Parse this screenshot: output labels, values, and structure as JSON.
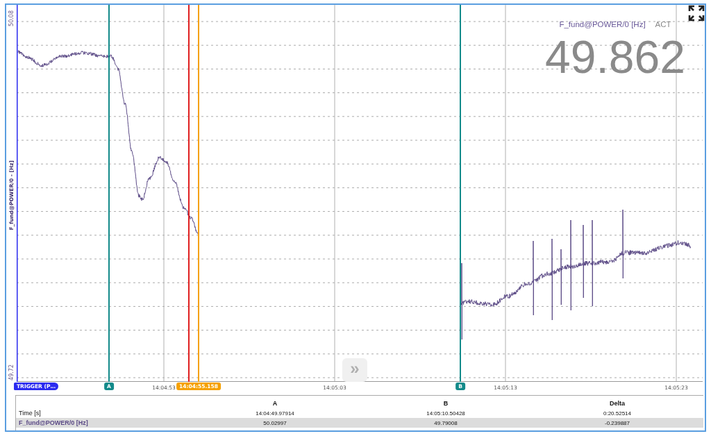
{
  "axis": {
    "label": "F_fund@POWER/0 - [Hz]",
    "y_max": "50.08",
    "y_min": "49.72"
  },
  "readout": {
    "channel": "F_fund@POWER/0 [Hz]",
    "mode": "ACT",
    "value": "49.862"
  },
  "x_ticks": [
    "14:04:53",
    "14:05:03",
    "14:05:13",
    "14:05:23"
  ],
  "cursors": [
    {
      "kind": "trigger",
      "label": "TRIGGER (P…",
      "color": "#2b2bf0"
    },
    {
      "kind": "marker",
      "label": "A",
      "color": "#138a8a"
    },
    {
      "kind": "line",
      "color": "#e02020"
    },
    {
      "kind": "time",
      "label": "14:04:55.158",
      "color": "#f5a000"
    },
    {
      "kind": "marker",
      "label": "B",
      "color": "#138a8a"
    }
  ],
  "scroll_button": {
    "label": "»"
  },
  "table": {
    "columns": [
      "A",
      "B",
      "Delta"
    ],
    "rows": [
      {
        "kind": "time",
        "label": "Time [s]",
        "values": [
          "14:04:49.97914",
          "14:05:10.50428",
          "0:20.52514"
        ],
        "selected": false
      },
      {
        "kind": "channel",
        "label": "F_fund@POWER/0 [Hz]",
        "values": [
          "50.02997",
          "49.79008",
          "-0.239887"
        ],
        "selected": true
      }
    ]
  }
}
